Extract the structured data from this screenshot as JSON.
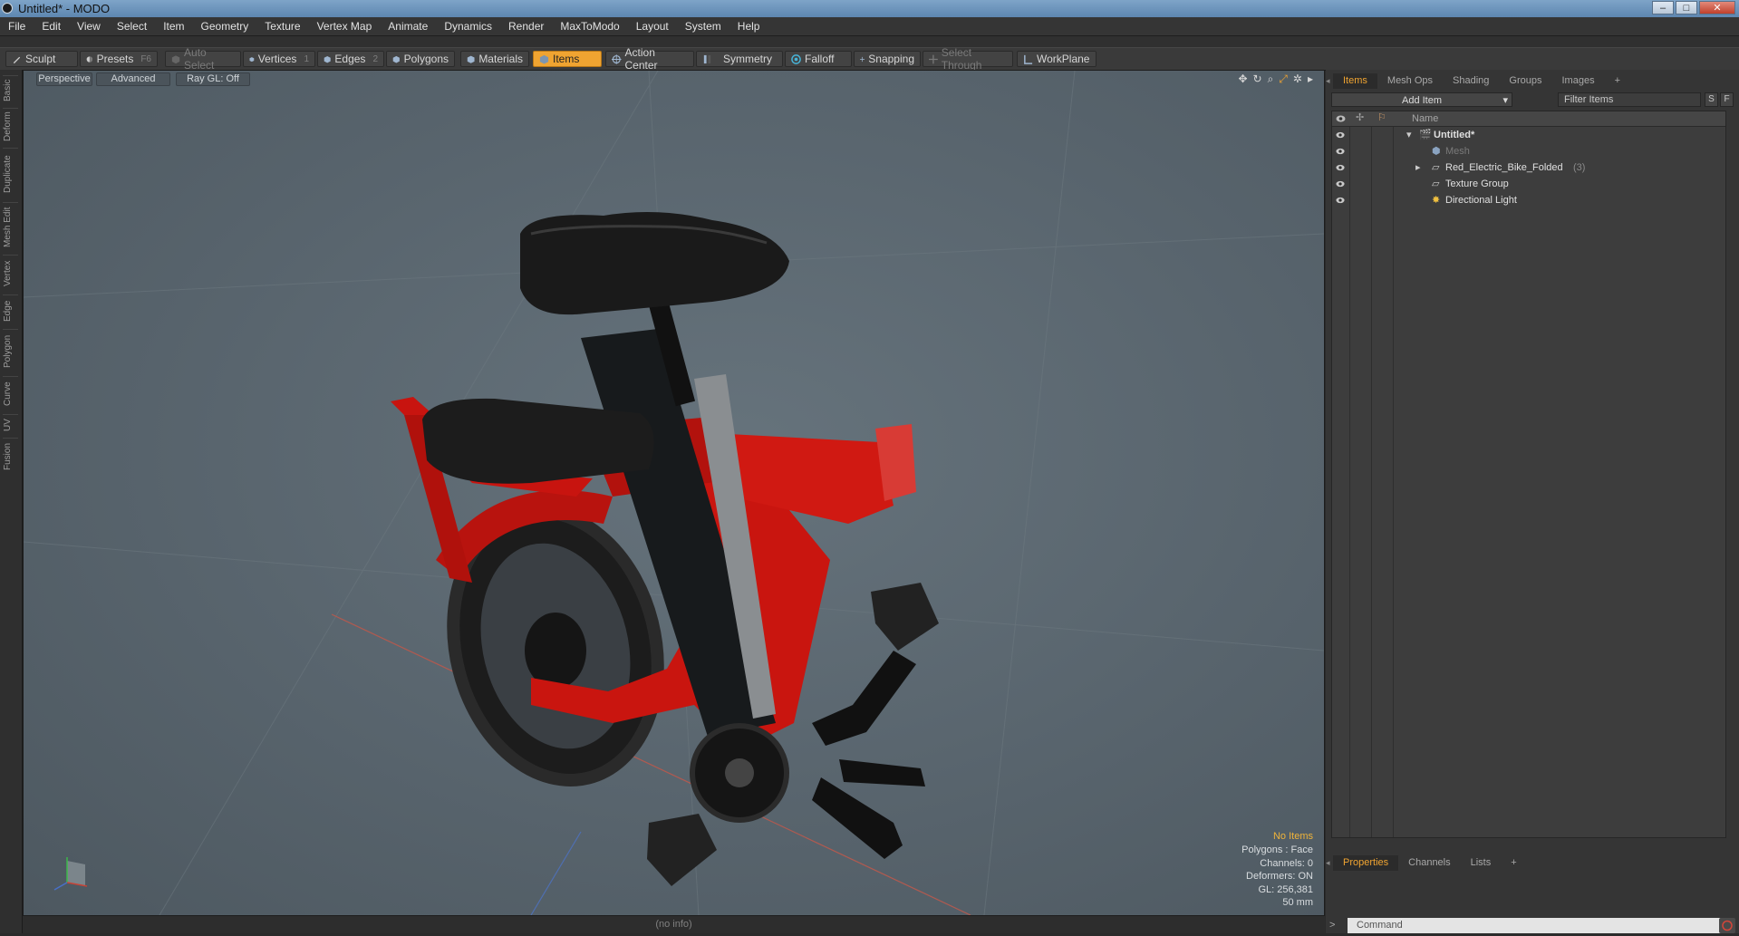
{
  "window": {
    "title": "Untitled* - MODO",
    "minimize": "–",
    "maximize": "□",
    "close": "✕"
  },
  "menu": [
    "File",
    "Edit",
    "View",
    "Select",
    "Item",
    "Geometry",
    "Texture",
    "Vertex Map",
    "Animate",
    "Dynamics",
    "Render",
    "MaxToModo",
    "Layout",
    "System",
    "Help"
  ],
  "toolbar": {
    "sculpt": "Sculpt",
    "presets": "Presets",
    "presets_key": "F6",
    "auto_select": "Auto Select",
    "vertices": "Vertices",
    "vertices_key": "1",
    "edges": "Edges",
    "edges_key": "2",
    "polygons": "Polygons",
    "materials": "Materials",
    "items": "Items",
    "action_center": "Action Center",
    "symmetry": "Symmetry",
    "falloff": "Falloff",
    "snapping": "Snapping",
    "select_through": "Select Through",
    "workplane": "WorkPlane"
  },
  "left_tabs": [
    "Basic",
    "Deform",
    "Duplicate",
    "Mesh Edit",
    "Vertex",
    "Edge",
    "Polygon",
    "Curve",
    "UV",
    "Fusion"
  ],
  "viewport": {
    "view": "Perspective",
    "mode": "Advanced",
    "raygl": "Ray GL: Off",
    "hud": {
      "selection": "No Items",
      "polygons": "Polygons : Face",
      "channels": "Channels: 0",
      "deformers": "Deformers: ON",
      "gl": "GL: 256,381",
      "scale": "50 mm"
    },
    "footer": "(no info)"
  },
  "right_panel": {
    "tabs": [
      "Items",
      "Mesh Ops",
      "Shading",
      "Groups",
      "Images"
    ],
    "plus": "+",
    "add_item": "Add Item",
    "filter_placeholder": "Filter Items",
    "s_btn": "S",
    "f_btn": "F",
    "column_name": "Name",
    "tree": [
      {
        "label": "Untitled*",
        "count": ""
      },
      {
        "label": "Mesh",
        "count": ""
      },
      {
        "label": "Red_Electric_Bike_Folded",
        "count": "(3)"
      },
      {
        "label": "Texture Group",
        "count": ""
      },
      {
        "label": "Directional Light",
        "count": ""
      }
    ],
    "bottom_tabs": [
      "Properties",
      "Channels",
      "Lists"
    ],
    "command_placeholder": "Command",
    "cmd_prompt": ">"
  },
  "colors": {
    "accent": "#f0a431",
    "bike_red": "#d0140f",
    "viewport_bg": "#5c6870"
  }
}
